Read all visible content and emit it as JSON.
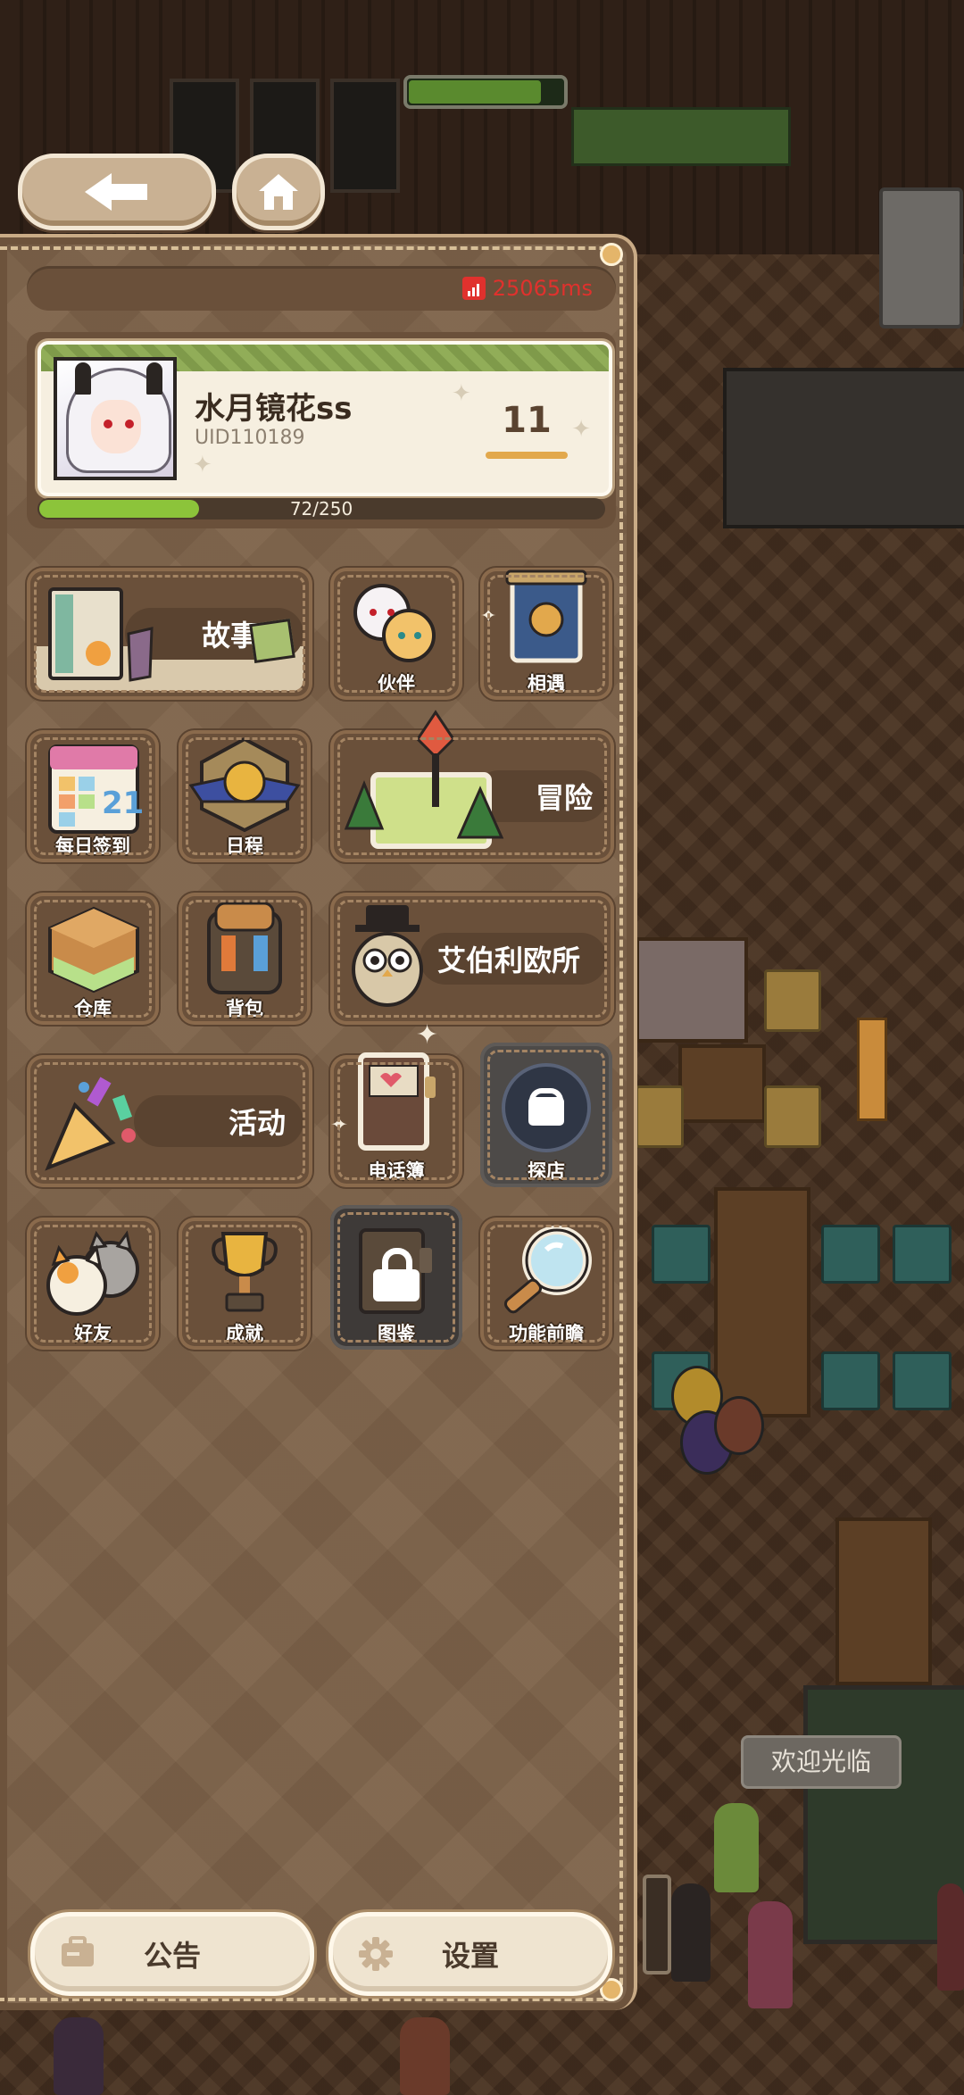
{
  "header": {
    "back_icon": "arrow-left-icon",
    "home_icon": "home-icon"
  },
  "network": {
    "ping": "25065ms",
    "icon": "signal-bars-icon",
    "color": "#e0312d"
  },
  "profile": {
    "name": "水月镜花ss",
    "uid": "UID110189",
    "level": "11",
    "xp_text": "72/250",
    "xp_fraction": 0.288
  },
  "tiles": {
    "story": "故事",
    "partner": "伙伴",
    "encounter": "相遇",
    "daily_signin": "每日签到",
    "calendar_day": "21",
    "schedule": "日程",
    "adventure": "冒险",
    "warehouse": "仓库",
    "backpack": "背包",
    "office": "艾伯利欧所",
    "activity": "活动",
    "phonebook": "电话簿",
    "explore_shop": "探店",
    "friends": "好友",
    "achievements": "成就",
    "gallery": "图鉴",
    "preview": "功能前瞻"
  },
  "bottom": {
    "notice": "公告",
    "settings": "设置"
  },
  "scene": {
    "welcome": "欢迎光临"
  }
}
